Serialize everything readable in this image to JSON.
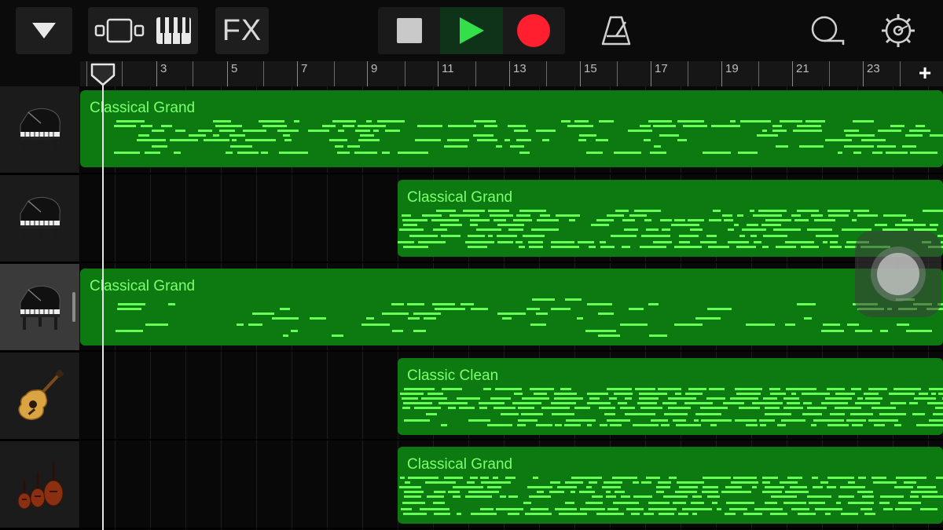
{
  "toolbar": {
    "browser_icon": "triangle-down-icon",
    "tracks_view_icon": "tracks-view-icon",
    "keyboard_icon": "piano-keyboard-icon",
    "fx_label": "FX",
    "stop_icon": "stop-icon",
    "play_icon": "play-icon",
    "record_icon": "record-icon",
    "metronome_icon": "metronome-icon",
    "loop_icon": "loop-icon",
    "settings_icon": "gear-icon"
  },
  "colors": {
    "region_fill": "#0c7a10",
    "region_text": "#7dff6e",
    "note": "#66ff55",
    "play_active": "#33e04a",
    "record": "#ff1f2e"
  },
  "ruler": {
    "labels": [
      "3",
      "5",
      "7",
      "9",
      "11",
      "13",
      "15",
      "17",
      "19",
      "21",
      "23"
    ],
    "add_label": "+"
  },
  "tracks": [
    {
      "instrument_icon": "grand-piano-icon",
      "selected": false,
      "region": {
        "name": "Classical Grand"
      }
    },
    {
      "instrument_icon": "grand-piano-icon",
      "selected": false,
      "region": {
        "name": "Classical Grand"
      }
    },
    {
      "instrument_icon": "grand-piano-icon",
      "selected": true,
      "region": {
        "name": "Classical Grand"
      }
    },
    {
      "instrument_icon": "acoustic-guitar-icon",
      "selected": false,
      "region": {
        "name": "Classic Clean"
      }
    },
    {
      "instrument_icon": "string-ensemble-icon",
      "selected": false,
      "region": {
        "name": "Classical Grand"
      }
    }
  ]
}
